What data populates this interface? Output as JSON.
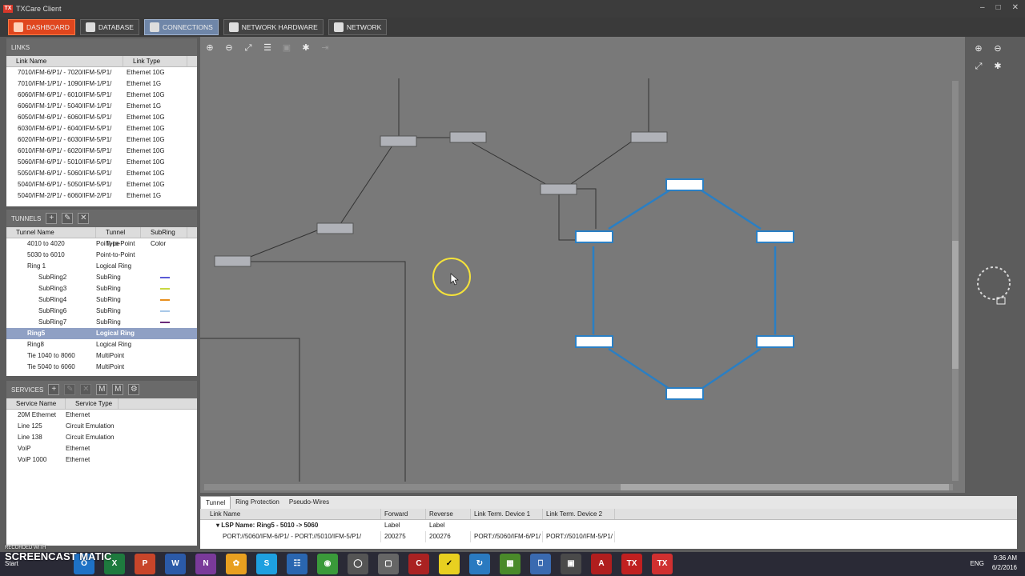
{
  "window": {
    "title": "TXCare Client",
    "app_icon_text": "TX"
  },
  "nav": [
    {
      "label": "DASHBOARD",
      "icon": "dashboard-icon",
      "style": "dash"
    },
    {
      "label": "DATABASE",
      "icon": "database-icon",
      "style": ""
    },
    {
      "label": "CONNECTIONS",
      "icon": "connections-icon",
      "style": "active"
    },
    {
      "label": "NETWORK HARDWARE",
      "icon": "network-hardware-icon",
      "style": ""
    },
    {
      "label": "NETWORK",
      "icon": "network-icon",
      "style": ""
    }
  ],
  "links": {
    "title": "LINKS",
    "columns": [
      "Link Name",
      "Link Type"
    ],
    "rows": [
      [
        "7010/IFM-6/P1/ - 7020/IFM-5/P1/",
        "Ethernet 10G"
      ],
      [
        "7010/IFM-1/P1/ - 1090/IFM-1/P1/",
        "Ethernet 1G"
      ],
      [
        "6060/IFM-6/P1/ - 6010/IFM-5/P1/",
        "Ethernet 10G"
      ],
      [
        "6060/IFM-1/P1/ - 5040/IFM-1/P1/",
        "Ethernet 1G"
      ],
      [
        "6050/IFM-6/P1/ - 6060/IFM-5/P1/",
        "Ethernet 10G"
      ],
      [
        "6030/IFM-6/P1/ - 6040/IFM-5/P1/",
        "Ethernet 10G"
      ],
      [
        "6020/IFM-6/P1/ - 6030/IFM-5/P1/",
        "Ethernet 10G"
      ],
      [
        "6010/IFM-6/P1/ - 6020/IFM-5/P1/",
        "Ethernet 10G"
      ],
      [
        "5060/IFM-6/P1/ - 5010/IFM-5/P1/",
        "Ethernet 10G"
      ],
      [
        "5050/IFM-6/P1/ - 5060/IFM-5/P1/",
        "Ethernet 10G"
      ],
      [
        "5040/IFM-6/P1/ - 5050/IFM-5/P1/",
        "Ethernet 10G"
      ],
      [
        "5040/IFM-2/P1/ - 6060/IFM-2/P1/",
        "Ethernet 1G"
      ]
    ]
  },
  "tunnels": {
    "title": "TUNNELS",
    "columns": [
      "Tunnel Name",
      "Tunnel Type",
      "SubRing Color"
    ],
    "rows": [
      {
        "name": "4010 to 4020",
        "type": "Point-to-Point",
        "indent": 1,
        "color": ""
      },
      {
        "name": "5030 to 6010",
        "type": "Point-to-Point",
        "indent": 1,
        "color": ""
      },
      {
        "name": "Ring 1",
        "type": "Logical Ring",
        "indent": 1,
        "color": ""
      },
      {
        "name": "SubRing2",
        "type": "SubRing",
        "indent": 2,
        "color": "#5a5ad6"
      },
      {
        "name": "SubRing3",
        "type": "SubRing",
        "indent": 2,
        "color": "#c8d840"
      },
      {
        "name": "SubRing4",
        "type": "SubRing",
        "indent": 2,
        "color": "#e8901e"
      },
      {
        "name": "SubRing6",
        "type": "SubRing",
        "indent": 2,
        "color": "#a8c8e8"
      },
      {
        "name": "SubRing7",
        "type": "SubRing",
        "indent": 2,
        "color": "#6a2a7a"
      },
      {
        "name": "Ring5",
        "type": "Logical Ring",
        "indent": 1,
        "color": "",
        "selected": true
      },
      {
        "name": "Ring8",
        "type": "Logical Ring",
        "indent": 1,
        "color": ""
      },
      {
        "name": "Tie 1040 to 8060",
        "type": "MultiPoint",
        "indent": 1,
        "color": ""
      },
      {
        "name": "Tie 5040 to 6060",
        "type": "MultiPoint",
        "indent": 1,
        "color": ""
      }
    ]
  },
  "services": {
    "title": "SERVICES",
    "columns": [
      "Service Name",
      "Service Type"
    ],
    "rows": [
      [
        "20M Ethernet",
        "Ethernet"
      ],
      [
        "Line 125",
        "Circuit Emulation"
      ],
      [
        "Line 138",
        "Circuit Emulation"
      ],
      [
        "VoiP",
        "Ethernet"
      ],
      [
        "VoiP 1000",
        "Ethernet"
      ]
    ]
  },
  "bottom": {
    "tabs": [
      "Tunnel",
      "Ring Protection",
      "Pseudo-Wires"
    ],
    "columns": [
      "Link Name",
      "Forward Label",
      "Reverse Label",
      "Link Term. Device 1",
      "Link Term. Device 2"
    ],
    "group": "LSP Name: Ring5 - 5010 -> 5060",
    "row": [
      "PORT://5060/IFM-6/P1/ - PORT://5010/IFM-5/P1/",
      "200275",
      "200276",
      "PORT://5060/IFM-6/P1/",
      "PORT://5010/IFM-5/P1/"
    ]
  },
  "taskbar": {
    "start": "Start",
    "watermark": "SCREENCAST",
    "watermark_brand": "MATIC",
    "watermark_sub": "RECORDED WITH",
    "lang": "ENG",
    "time": "9:36 AM",
    "date": "6/2/2016"
  },
  "colors": {
    "ring": "#2a7fc4",
    "accent": "#e0461e"
  }
}
